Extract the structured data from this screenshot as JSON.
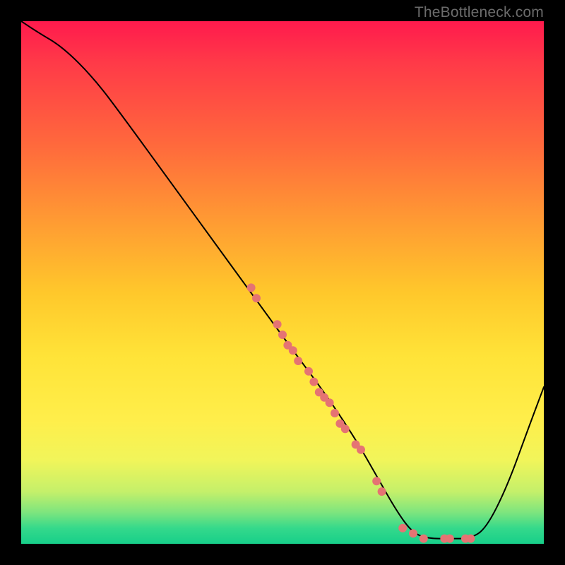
{
  "watermark": "TheBottleneck.com",
  "chart_data": {
    "type": "line",
    "title": "",
    "xlabel": "",
    "ylabel": "",
    "xlim": [
      0,
      100
    ],
    "ylim": [
      0,
      100
    ],
    "curve": [
      {
        "x": 0,
        "y": 100
      },
      {
        "x": 3,
        "y": 98
      },
      {
        "x": 8,
        "y": 95
      },
      {
        "x": 14,
        "y": 89
      },
      {
        "x": 20,
        "y": 81
      },
      {
        "x": 28,
        "y": 70
      },
      {
        "x": 36,
        "y": 59
      },
      {
        "x": 44,
        "y": 48
      },
      {
        "x": 52,
        "y": 37
      },
      {
        "x": 58,
        "y": 29
      },
      {
        "x": 64,
        "y": 20
      },
      {
        "x": 68,
        "y": 13
      },
      {
        "x": 72,
        "y": 6
      },
      {
        "x": 75,
        "y": 2
      },
      {
        "x": 78,
        "y": 1
      },
      {
        "x": 82,
        "y": 1
      },
      {
        "x": 86,
        "y": 1
      },
      {
        "x": 89,
        "y": 3
      },
      {
        "x": 93,
        "y": 11
      },
      {
        "x": 97,
        "y": 22
      },
      {
        "x": 100,
        "y": 30
      }
    ],
    "scatter": [
      {
        "x": 44,
        "y": 49
      },
      {
        "x": 45,
        "y": 47
      },
      {
        "x": 49,
        "y": 42
      },
      {
        "x": 50,
        "y": 40
      },
      {
        "x": 51,
        "y": 38
      },
      {
        "x": 52,
        "y": 37
      },
      {
        "x": 53,
        "y": 35
      },
      {
        "x": 55,
        "y": 33
      },
      {
        "x": 56,
        "y": 31
      },
      {
        "x": 57,
        "y": 29
      },
      {
        "x": 58,
        "y": 28
      },
      {
        "x": 59,
        "y": 27
      },
      {
        "x": 60,
        "y": 25
      },
      {
        "x": 61,
        "y": 23
      },
      {
        "x": 62,
        "y": 22
      },
      {
        "x": 64,
        "y": 19
      },
      {
        "x": 65,
        "y": 18
      },
      {
        "x": 68,
        "y": 12
      },
      {
        "x": 69,
        "y": 10
      },
      {
        "x": 73,
        "y": 3
      },
      {
        "x": 75,
        "y": 2
      },
      {
        "x": 77,
        "y": 1
      },
      {
        "x": 81,
        "y": 1
      },
      {
        "x": 82,
        "y": 1
      },
      {
        "x": 85,
        "y": 1
      },
      {
        "x": 86,
        "y": 1
      }
    ],
    "dot_radius": 6
  }
}
